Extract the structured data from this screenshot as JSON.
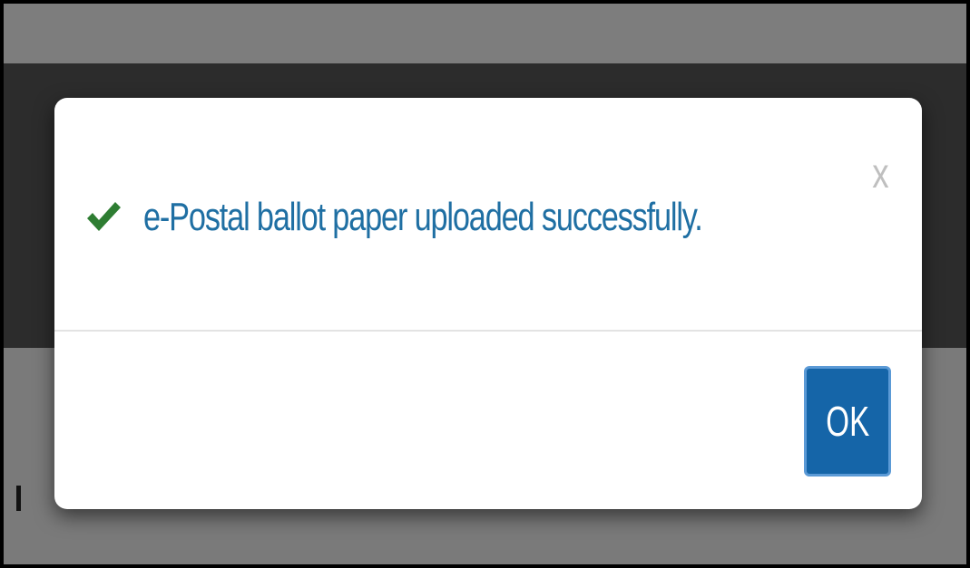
{
  "dialog": {
    "message": "e-Postal ballot paper uploaded successfully.",
    "close_label": "x",
    "ok_label": "OK"
  },
  "icons": {
    "status": "check-icon",
    "close": "close-icon"
  },
  "colors": {
    "message_text": "#1f6fa3",
    "check": "#2e7d32",
    "ok_button": "#1565a8",
    "backdrop_dark": "#2c2c2c",
    "backdrop_gray": "#7a7a7a"
  }
}
